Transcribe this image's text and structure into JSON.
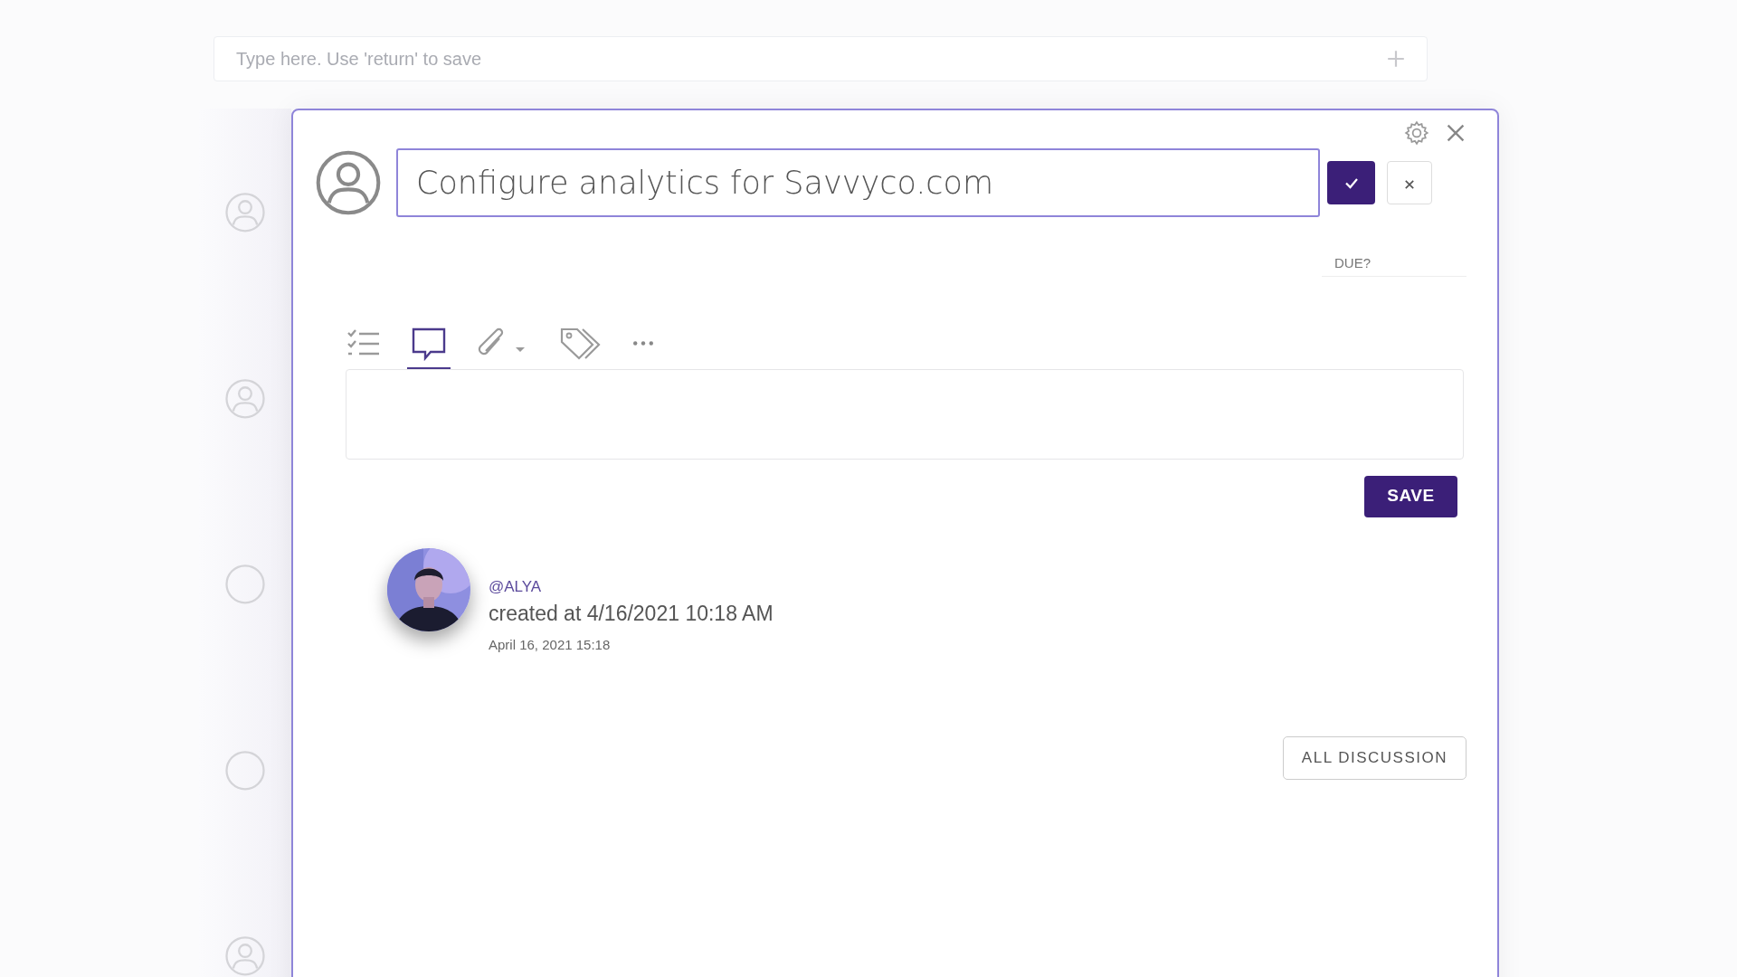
{
  "quick_add": {
    "placeholder": "Type here. Use 'return' to save"
  },
  "task_list": [
    {
      "kind": "assignee"
    },
    {
      "kind": "assignee"
    },
    {
      "kind": "empty"
    },
    {
      "kind": "empty"
    },
    {
      "kind": "assignee"
    }
  ],
  "dialog": {
    "title_field": {
      "value": "Configure analytics for Savvyco.com"
    },
    "due_label": "DUE?",
    "toolbar": [
      {
        "kind": "checklist",
        "selected": false
      },
      {
        "kind": "comment",
        "selected": true
      },
      {
        "kind": "attachment",
        "selected": false
      },
      {
        "kind": "tags",
        "selected": false
      },
      {
        "kind": "more",
        "selected": false
      }
    ],
    "save_button": "SAVE",
    "activity": [
      {
        "user": "@ALYA",
        "text": "created at 4/16/2021 10:18 AM",
        "time": "April 16, 2021 15:18"
      }
    ],
    "all_discussion_button": "ALL DISCUSSION"
  }
}
